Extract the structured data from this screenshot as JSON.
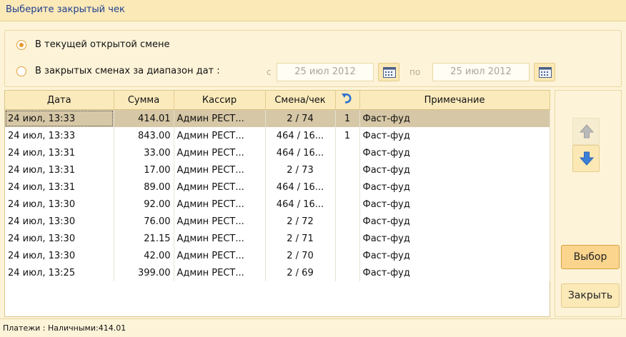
{
  "window": {
    "title": "Выберите закрытый чек"
  },
  "filter": {
    "option_current": "В текущей открытой смене",
    "option_range": "В закрытых сменах за диапазон дат  :",
    "from_label": "с",
    "from_date": "25 июл 2012",
    "to_label": "по",
    "to_date": "25 июл 2012",
    "selected_option": "current"
  },
  "table": {
    "headers": [
      "Дата",
      "Сумма",
      "Кассир",
      "Смена/чек",
      "",
      "Примечание"
    ],
    "return_icon": "undo-arrow-icon",
    "rows": [
      {
        "date": "24 июл, 13:33",
        "sum": "414.01",
        "cashier": "Админ РЕСТ...",
        "shift": "2 / 74",
        "ret": "1",
        "note": "Фаст-фуд"
      },
      {
        "date": "24 июл, 13:33",
        "sum": "843.00",
        "cashier": "Админ РЕСТ...",
        "shift": "464 / 16...",
        "ret": "1",
        "note": "Фаст-фуд"
      },
      {
        "date": "24 июл, 13:31",
        "sum": "33.00",
        "cashier": "Админ РЕСТ...",
        "shift": "464 / 16...",
        "ret": "",
        "note": "Фаст-фуд"
      },
      {
        "date": "24 июл, 13:31",
        "sum": "17.00",
        "cashier": "Админ РЕСТ...",
        "shift": "2 / 73",
        "ret": "",
        "note": "Фаст-фуд"
      },
      {
        "date": "24 июл, 13:31",
        "sum": "89.00",
        "cashier": "Админ РЕСТ...",
        "shift": "464 / 16...",
        "ret": "",
        "note": "Фаст-фуд"
      },
      {
        "date": "24 июл, 13:30",
        "sum": "92.00",
        "cashier": "Админ РЕСТ...",
        "shift": "464 / 16...",
        "ret": "",
        "note": "Фаст-фуд"
      },
      {
        "date": "24 июл, 13:30",
        "sum": "76.00",
        "cashier": "Админ РЕСТ...",
        "shift": "2 / 72",
        "ret": "",
        "note": "Фаст-фуд"
      },
      {
        "date": "24 июл, 13:30",
        "sum": "21.15",
        "cashier": "Админ РЕСТ...",
        "shift": "2 / 71",
        "ret": "",
        "note": "Фаст-фуд"
      },
      {
        "date": "24 июл, 13:30",
        "sum": "42.00",
        "cashier": "Админ РЕСТ...",
        "shift": "2 / 70",
        "ret": "",
        "note": "Фаст-фуд"
      },
      {
        "date": "24 июл, 13:25",
        "sum": "399.00",
        "cashier": "Админ РЕСТ...",
        "shift": "2 / 69",
        "ret": "",
        "note": "Фаст-фуд"
      }
    ]
  },
  "sidebar": {
    "up_icon": "arrow-up-icon",
    "down_icon": "arrow-down-icon",
    "select_label": "Выбор",
    "close_label": "Закрыть"
  },
  "status": {
    "text": "Платежи :   Наличными:414.01"
  },
  "colors": {
    "title_text": "#1f3f8f",
    "accent": "#e59a2c",
    "selected_row": "#d6c7a6",
    "arrow_blue": "#3b7fd9"
  }
}
